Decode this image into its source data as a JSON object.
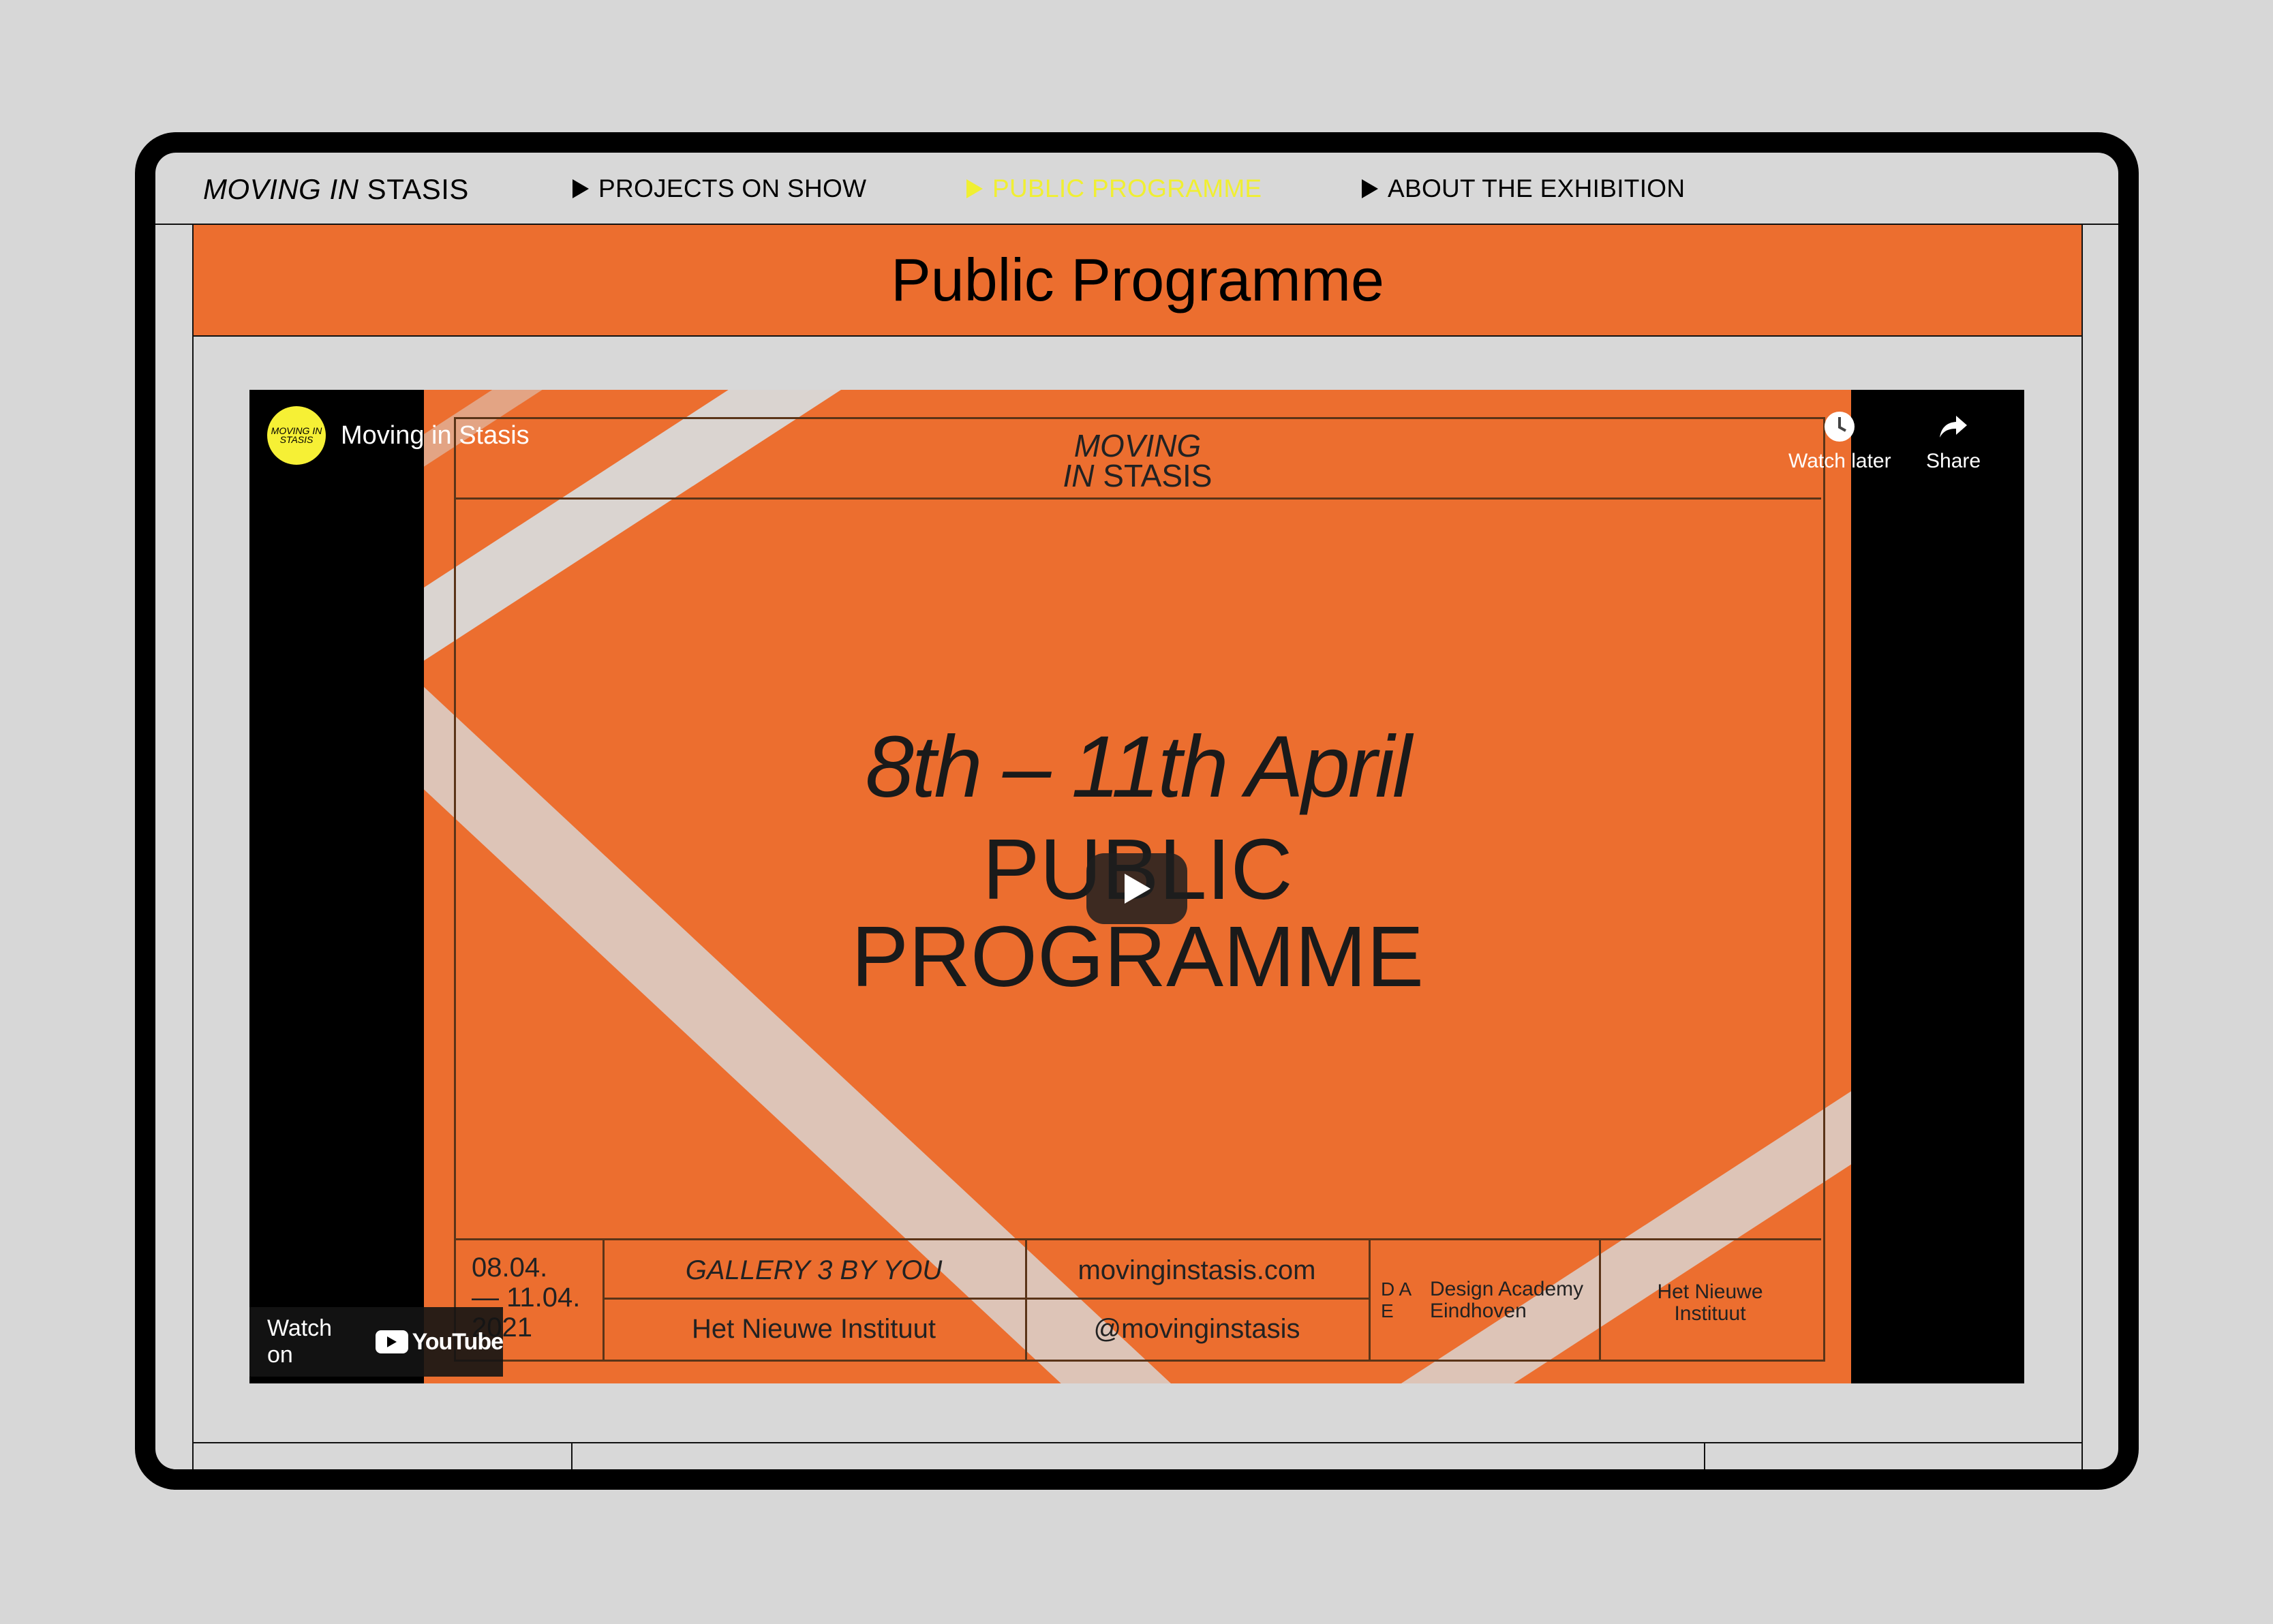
{
  "nav": {
    "logo_italic": "MOVING IN",
    "logo_rest": " STASIS",
    "items": [
      {
        "label": "PROJECTS ON SHOW",
        "active": false
      },
      {
        "label": "PUBLIC PROGRAMME",
        "active": true
      },
      {
        "label": "ABOUT THE EXHIBITION",
        "active": false
      }
    ],
    "active_color": "#f0ef32"
  },
  "banner": {
    "title": "Public Programme",
    "color": "#ec6e2f"
  },
  "video": {
    "channel_avatar_text": "MOVING IN STASIS",
    "channel_name": "Moving in Stasis",
    "watch_later_label": "Watch later",
    "share_label": "Share",
    "watch_on_label": "Watch on",
    "youtube_label": "YouTube",
    "poster": {
      "logo_line1": "MOVING",
      "logo_line2_italic": "IN",
      "logo_line2_rest": " STASIS",
      "date": "8th – 11th April",
      "title_line1": "PUBLIC",
      "title_line2": "PROGRAMME",
      "footer": {
        "dates": [
          "08.04.",
          "— 11.04.",
          "2021"
        ],
        "gallery": "GALLERY 3 BY YOU",
        "venue": "Het Nieuwe Instituut",
        "website": "movinginstasis.com",
        "handle": "@movinginstasis",
        "dae_mark": [
          "D A",
          "E"
        ],
        "dae_name": [
          "Design Academy",
          "Eindhoven"
        ],
        "hni_name": [
          "Het Nieuwe",
          "Instituut"
        ]
      }
    }
  }
}
